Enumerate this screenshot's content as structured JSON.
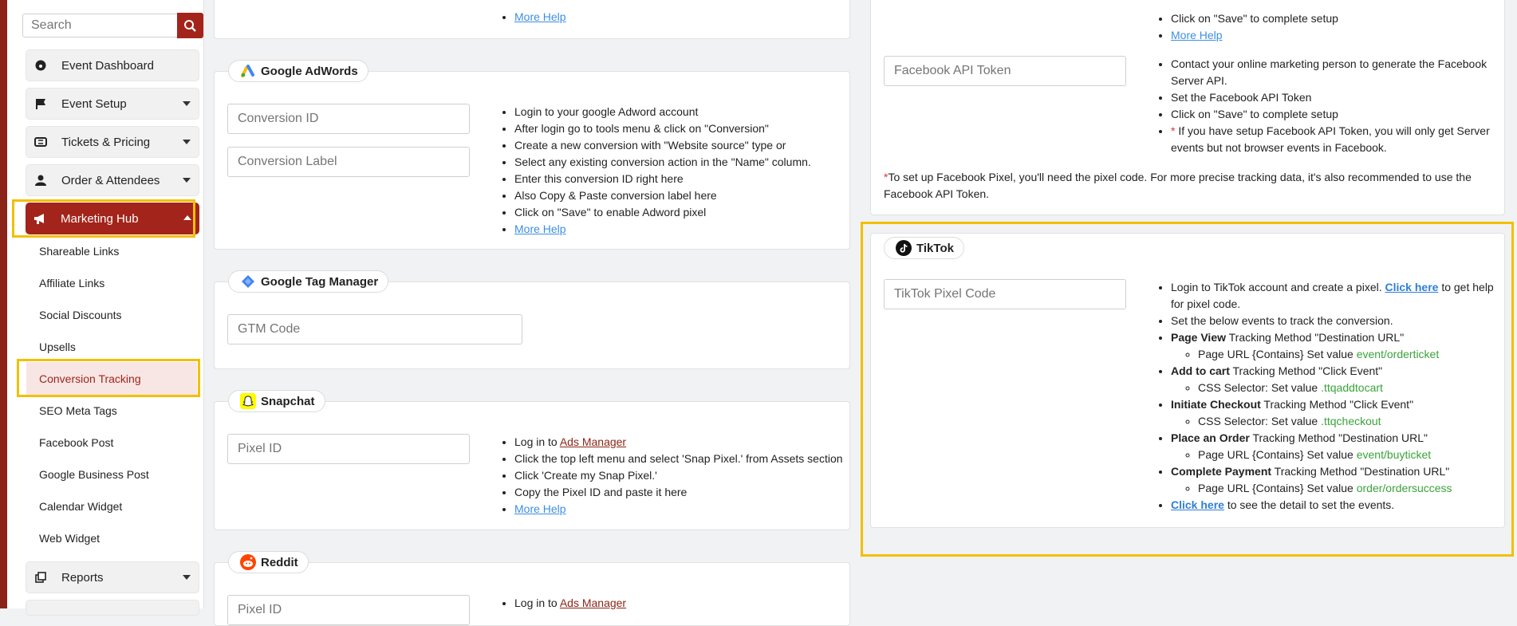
{
  "sidebar": {
    "search_placeholder": "Search",
    "nav": [
      {
        "label": "Event Dashboard"
      },
      {
        "label": "Event Setup"
      },
      {
        "label": "Tickets & Pricing"
      },
      {
        "label": "Order & Attendees"
      },
      {
        "label": "Marketing Hub"
      },
      {
        "label": "Reports"
      }
    ],
    "sub_items": [
      "Shareable Links",
      "Affiliate Links",
      "Social Discounts",
      "Upsells",
      "Conversion Tracking",
      "SEO Meta Tags",
      "Facebook Post",
      "Google Business Post",
      "Calendar Widget",
      "Web Widget"
    ],
    "accent_color": "#a3241a",
    "highlight_color": "#f2c000"
  },
  "top_card": {
    "more_help": "More Help"
  },
  "adwords": {
    "title": "Google AdWords",
    "conversion_id_placeholder": "Conversion ID",
    "conversion_label_placeholder": "Conversion Label",
    "steps": [
      "Login to your google Adword account",
      "After login go to tools menu & click on \"Conversion\"",
      "Create a new conversion with \"Website source\" type or",
      "Select any existing conversion action in the \"Name\" column.",
      "Enter this conversion ID right here",
      "Also Copy & Paste conversion label here",
      "Click on \"Save\" to enable Adword pixel"
    ],
    "more_help": "More Help"
  },
  "gtm": {
    "title": "Google Tag Manager",
    "placeholder": "GTM Code"
  },
  "snapchat": {
    "title": "Snapchat",
    "placeholder": "Pixel ID",
    "step1_prefix": "Log in to ",
    "step1_link": "Ads Manager",
    "steps": [
      "Click the top left menu and select 'Snap Pixel.' from Assets section",
      "Click 'Create my Snap Pixel.'",
      "Copy the Pixel ID and paste it here"
    ],
    "more_help": "More Help"
  },
  "reddit": {
    "title": "Reddit",
    "placeholder": "Pixel ID",
    "step1_prefix": "Log in to ",
    "step1_link": "Ads Manager"
  },
  "facebook": {
    "top_step": "Click on \"Save\" to complete setup",
    "more_help": "More Help",
    "api_placeholder": "Facebook API Token",
    "api_steps": [
      "Contact your online marketing person to generate the Facebook Server API.",
      "Set the Facebook API Token",
      "Click on \"Save\" to complete setup"
    ],
    "warning_star": "*",
    "warning": " If you have setup Facebook API Token, you will only get Server events but not browser events in Facebook.",
    "note_star": "*",
    "note": "To set up Facebook Pixel, you'll need the pixel code. For more precise tracking data, it's also recommended to use the Facebook API Token."
  },
  "tiktok": {
    "title": "TikTok",
    "placeholder": "TikTok Pixel Code",
    "login_prefix": "Login to TikTok account and create a pixel. ",
    "login_link": "Click here",
    "login_suffix": " to get help for pixel code.",
    "set_events": "Set the below events to track the conversion.",
    "events": [
      {
        "name": "Page View",
        "method": " Tracking Method \"Destination URL\"",
        "detail": "Page URL {Contains} Set value ",
        "value": "event/orderticket"
      },
      {
        "name": "Add to cart",
        "method": " Tracking Method \"Click Event\"",
        "detail": "CSS Selector: Set value ",
        "value": ".ttqaddtocart"
      },
      {
        "name": "Initiate Checkout",
        "method": " Tracking Method \"Click Event\"",
        "detail": "CSS Selector: Set value ",
        "value": ".ttqcheckout"
      },
      {
        "name": "Place an Order",
        "method": " Tracking Method \"Destination URL\"",
        "detail": "Page URL {Contains} Set value ",
        "value": "event/buyticket"
      },
      {
        "name": "Complete Payment",
        "method": " Tracking Method \"Destination URL\"",
        "detail": "Page URL {Contains} Set value ",
        "value": "order/ordersuccess"
      }
    ],
    "detail_link": "Click here",
    "detail_suffix": " to see the detail to set the events."
  }
}
